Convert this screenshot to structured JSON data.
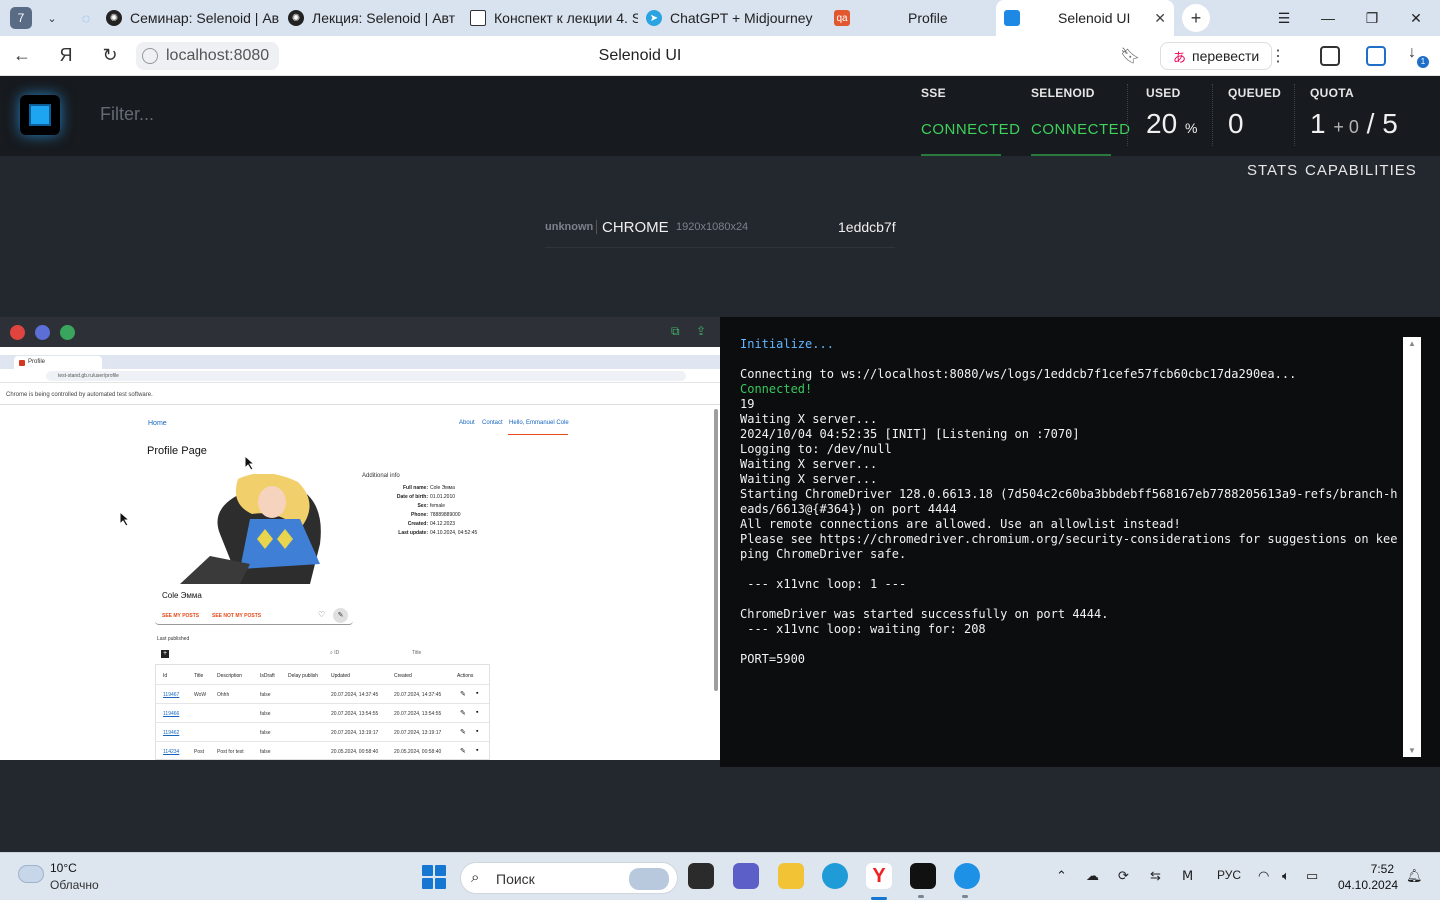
{
  "browser": {
    "tab_count": "7",
    "tabs": [
      {
        "title": "Семинар: Selenoid | Ав"
      },
      {
        "title": "Лекция: Selenoid | Авт"
      },
      {
        "title": "Конспект к лекции 4. S"
      },
      {
        "title": "ChatGPT + Midjourney"
      },
      {
        "title": "Profile"
      },
      {
        "title": "Selenoid UI"
      }
    ],
    "url": "localhost:8080",
    "page_title": "Selenoid UI",
    "translate_label": "перевести",
    "downloads_badge": "1"
  },
  "selenoid": {
    "filter_placeholder": "Filter...",
    "sse": {
      "label": "SSE",
      "status": "CONNECTED"
    },
    "selenoid_status": {
      "label": "SELENOID",
      "status": "CONNECTED"
    },
    "used": {
      "label": "USED",
      "value": "20",
      "unit": "%"
    },
    "queued": {
      "label": "QUEUED",
      "value": "0"
    },
    "quota": {
      "label": "QUOTA",
      "used": "1",
      "pending": "+ 0",
      "separator": "/",
      "total": "5"
    },
    "nav": {
      "stats": "STATS",
      "capabilities": "CAPABILITIES"
    },
    "session": {
      "user": "unknown",
      "browser": "CHROME",
      "resolution": "1920x1080x24",
      "id": "1eddcb7f"
    }
  },
  "remote": {
    "tab_title": "Profile",
    "url": "test-stand.gb.ru/user/profile",
    "info_bar": "Chrome is being controlled by automated test software.",
    "nav": {
      "home": "Home",
      "about": "About",
      "contact": "Contact",
      "hello": "Hello, Emmanuel Cole"
    },
    "page_title": "Profile Page",
    "additional_info": "Additional info",
    "fields": [
      {
        "k": "Full name:",
        "v": "Cole Эмма"
      },
      {
        "k": "Date of birth:",
        "v": "01.01.2010"
      },
      {
        "k": "Sex:",
        "v": "female"
      },
      {
        "k": "Phone:",
        "v": "78889889000"
      },
      {
        "k": "Created:",
        "v": "04.12.2023"
      },
      {
        "k": "Last update:",
        "v": "04.10.2024, 04:52:45"
      }
    ],
    "name": "Cole Эмма",
    "see_my_posts": "SEE MY POSTS",
    "see_not_my_posts": "SEE NOT MY POSTS",
    "last_published": "Last published",
    "search_id": "ID",
    "search_title": "Title",
    "columns": [
      "Id",
      "Title",
      "Description",
      "IsDraft",
      "Delay publish",
      "Updated",
      "Created",
      "Actions"
    ],
    "rows": [
      {
        "id": "119467",
        "title": "WoW",
        "desc": "Ohhh",
        "draft": "false",
        "delay": "",
        "updated": "20.07.2024, 14:37:45",
        "created": "20.07.2024, 14:37:45"
      },
      {
        "id": "119466",
        "title": "",
        "desc": "",
        "draft": "false",
        "delay": "",
        "updated": "20.07.2024, 13:54:55",
        "created": "20.07.2024, 13:54:55"
      },
      {
        "id": "119462",
        "title": "",
        "desc": "",
        "draft": "false",
        "delay": "",
        "updated": "20.07.2024, 13:19:17",
        "created": "20.07.2024, 13:19:17"
      },
      {
        "id": "114234",
        "title": "Post",
        "desc": "Post for test",
        "draft": "false",
        "delay": "",
        "updated": "20.05.2024, 00:58:40",
        "created": "20.05.2024, 00:58:40"
      }
    ]
  },
  "logs": {
    "lines": [
      "Initialize...",
      "",
      "Connecting to ws://localhost:8080/ws/logs/1eddcb7f1cefe57fcb60cbc17da290ea...",
      "Connected!",
      "19",
      "Waiting X server...",
      "2024/10/04 04:52:35 [INIT] [Listening on :7070]",
      "Logging to: /dev/null",
      "Waiting X server...",
      "Waiting X server...",
      "Starting ChromeDriver 128.0.6613.18 (7d504c2c60ba3bbdebff568167eb7788205613a9-refs/branch-heads/6613@{#364}) on port 4444",
      "All remote connections are allowed. Use an allowlist instead!",
      "Please see https://chromedriver.chromium.org/security-considerations for suggestions on keeping ChromeDriver safe.",
      "",
      " --- x11vnc loop: 1 ---",
      "",
      "ChromeDriver was started successfully on port 4444.",
      " --- x11vnc loop: waiting for: 208",
      "",
      "PORT=5900"
    ]
  },
  "taskbar": {
    "weather_temp": "10°C",
    "weather_desc": "Облачно",
    "search_placeholder": "Поиск",
    "lang": "РУС",
    "time": "7:52",
    "date": "04.10.2024"
  }
}
